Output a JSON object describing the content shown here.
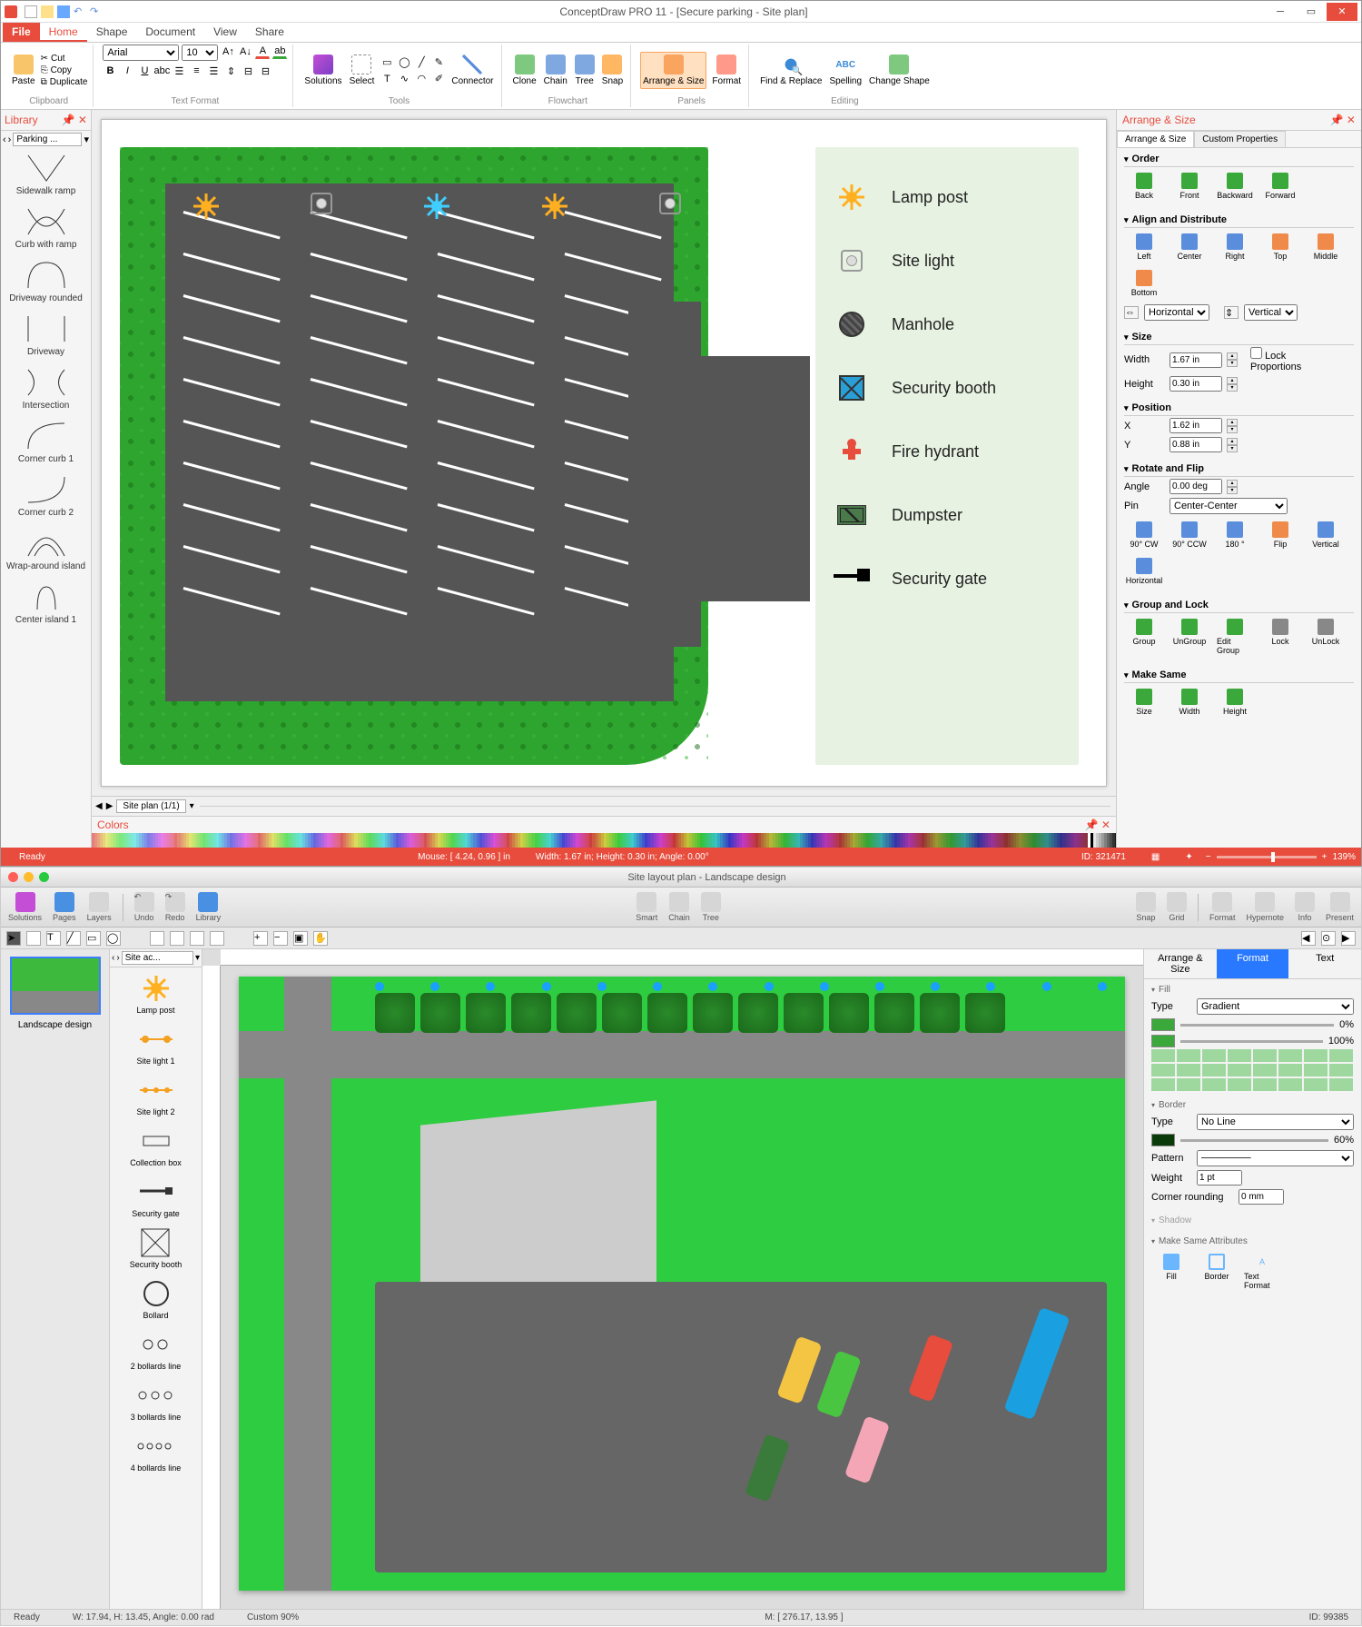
{
  "win": {
    "title": "ConceptDraw PRO 11 - [Secure parking - Site plan]",
    "tabs": [
      "File",
      "Home",
      "Shape",
      "Document",
      "View",
      "Share"
    ],
    "active_tab": "Home",
    "clipboard": {
      "paste": "Paste",
      "cut": "Cut",
      "copy": "Copy",
      "dup": "Duplicate",
      "label": "Clipboard"
    },
    "textfmt": {
      "font": "Arial",
      "size": "10",
      "label": "Text Format"
    },
    "tools": {
      "solutions": "Solutions",
      "select": "Select",
      "connector": "Connector",
      "label": "Tools"
    },
    "flow": {
      "clone": "Clone",
      "chain": "Chain",
      "tree": "Tree",
      "snap": "Snap",
      "label": "Flowchart"
    },
    "panels": {
      "arrange": "Arrange & Size",
      "format": "Format",
      "label": "Panels"
    },
    "editing": {
      "find": "Find & Replace",
      "spell": "Spelling",
      "chg": "Change Shape",
      "label": "Editing"
    },
    "library": {
      "hdr": "Library",
      "combo": "Parking ...",
      "shapes": [
        "Sidewalk ramp",
        "Curb with ramp",
        "Driveway rounded",
        "Driveway",
        "Intersection",
        "Corner curb 1",
        "Corner curb 2",
        "Wrap-around island",
        "Center island 1"
      ]
    },
    "legend": [
      "Lamp post",
      "Site light",
      "Manhole",
      "Security booth",
      "Fire hydrant",
      "Dumpster",
      "Security gate"
    ],
    "pages": "Site plan (1/1)",
    "colors_hdr": "Colors",
    "right": {
      "hdr": "Arrange & Size",
      "tabs": [
        "Arrange & Size",
        "Custom Properties"
      ],
      "order": {
        "hdr": "Order",
        "btns": [
          "Back",
          "Front",
          "Backward",
          "Forward"
        ]
      },
      "align": {
        "hdr": "Align and Distribute",
        "btns": [
          "Left",
          "Center",
          "Right",
          "Top",
          "Middle",
          "Bottom"
        ],
        "h": "Horizontal",
        "v": "Vertical"
      },
      "size": {
        "hdr": "Size",
        "w": "Width",
        "wv": "1.67 in",
        "h": "Height",
        "hv": "0.30 in",
        "lock": "Lock Proportions"
      },
      "pos": {
        "hdr": "Position",
        "x": "X",
        "xv": "1.62 in",
        "y": "Y",
        "yv": "0.88 in"
      },
      "rot": {
        "hdr": "Rotate and Flip",
        "a": "Angle",
        "av": "0.00 deg",
        "p": "Pin",
        "pv": "Center-Center",
        "btns": [
          "90° CW",
          "90° CCW",
          "180 °",
          "Flip",
          "Vertical",
          "Horizontal"
        ]
      },
      "grp": {
        "hdr": "Group and Lock",
        "btns": [
          "Group",
          "UnGroup",
          "Edit Group",
          "Lock",
          "UnLock"
        ]
      },
      "ms": {
        "hdr": "Make Same",
        "btns": [
          "Size",
          "Width",
          "Height"
        ]
      }
    },
    "status": {
      "ready": "Ready",
      "mouse": "Mouse: [ 4.24, 0.96 ] in",
      "dims": "Width: 1.67 in;  Height: 0.30 in;  Angle: 0.00°",
      "id": "ID: 321471",
      "zoom": "139%"
    }
  },
  "mac": {
    "title": "Site layout plan - Landscape design",
    "toolbar": {
      "solutions": "Solutions",
      "pages": "Pages",
      "layers": "Layers",
      "undo": "Undo",
      "redo": "Redo",
      "library": "Library",
      "smart": "Smart",
      "chain": "Chain",
      "tree": "Tree",
      "snap": "Snap",
      "grid": "Grid",
      "format": "Format",
      "hypernote": "Hypernote",
      "info": "Info",
      "present": "Present"
    },
    "thumb_label": "Landscape design",
    "shapes_hdr": "Site ac...",
    "shapes": [
      "Lamp post",
      "Site light 1",
      "Site light 2",
      "Collection box",
      "Security gate",
      "Security booth",
      "Bollard",
      "2 bollards line",
      "3 bollards line",
      "4 bollards line"
    ],
    "format": {
      "tabs": [
        "Arrange & Size",
        "Format",
        "Text"
      ],
      "fill": {
        "hdr": "Fill",
        "type": "Type",
        "typev": "Gradient",
        "p0": "0%",
        "p1": "100%"
      },
      "border": {
        "hdr": "Border",
        "type": "Type",
        "typev": "No Line",
        "opacity": "60%",
        "pattern": "Pattern",
        "weight": "Weight",
        "weightv": "1 pt",
        "cr": "Corner rounding",
        "crv": "0 mm"
      },
      "shadow": "Shadow",
      "msa": {
        "hdr": "Make Same Attributes",
        "btns": [
          "Fill",
          "Border",
          "Text Format"
        ]
      }
    },
    "status": {
      "ready": "Ready",
      "dims": "W: 17.94,  H: 13.45,  Angle: 0.00 rad",
      "custom": "Custom 90%",
      "m": "M: [ 276.17, 13.95 ]",
      "id": "ID: 99385"
    }
  }
}
